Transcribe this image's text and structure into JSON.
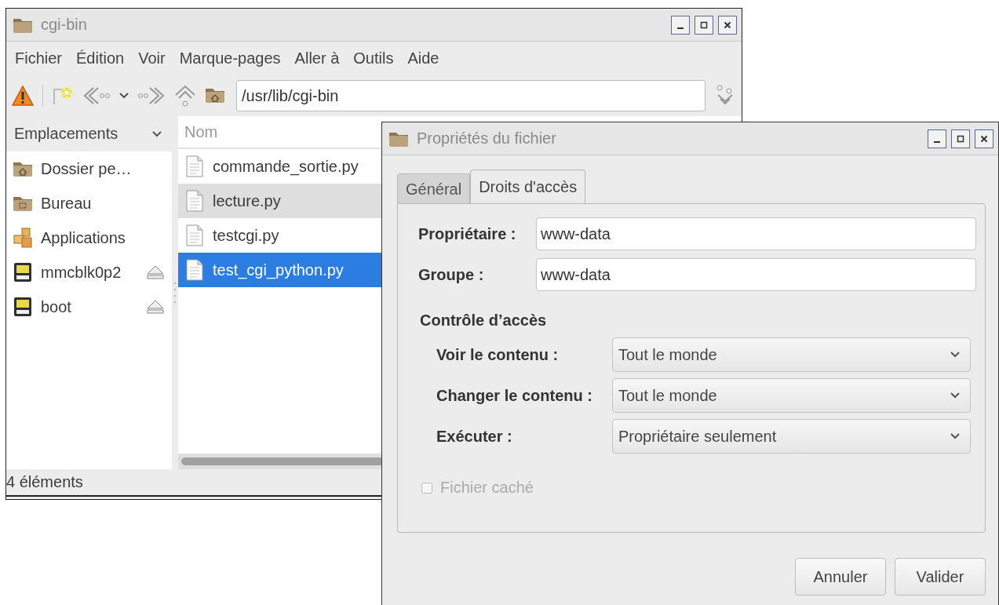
{
  "file_manager": {
    "window": {
      "title": "cgi-bin"
    },
    "menu": [
      "Fichier",
      "Édition",
      "Voir",
      "Marque-pages",
      "Aller à",
      "Outils",
      "Aide"
    ],
    "toolbar": {
      "path": "/usr/lib/cgi-bin"
    },
    "sidebar": {
      "header": "Emplacements",
      "items": [
        {
          "label": "Dossier pe…",
          "kind": "home"
        },
        {
          "label": "Bureau",
          "kind": "desktop"
        },
        {
          "label": "Applications",
          "kind": "applications"
        },
        {
          "label": "mmcblk0p2",
          "kind": "drive"
        },
        {
          "label": "boot",
          "kind": "drive"
        }
      ]
    },
    "file_list": {
      "columns": [
        "Nom"
      ],
      "rows": [
        {
          "name": "commande_sortie.py",
          "selected": false,
          "hovered": false
        },
        {
          "name": "lecture.py",
          "selected": false,
          "hovered": true
        },
        {
          "name": "testcgi.py",
          "selected": false,
          "hovered": false
        },
        {
          "name": "test_cgi_python.py",
          "selected": true,
          "hovered": false
        }
      ]
    },
    "status_bar": "4 éléments"
  },
  "dialog": {
    "window": {
      "title": "Propriétés du fichier"
    },
    "tabs": [
      {
        "label": "Général",
        "selected": false
      },
      {
        "label": "Droits d'accès",
        "selected": true
      }
    ],
    "fields": [
      {
        "label": "Propriétaire :",
        "value": "www-data"
      },
      {
        "label": "Groupe :",
        "value": "www-data"
      }
    ],
    "section": "Contrôle d’accès",
    "permissions": [
      {
        "label": "Voir le contenu :",
        "value": "Tout le monde"
      },
      {
        "label": "Changer le contenu :",
        "value": "Tout le monde"
      },
      {
        "label": "Exécuter :",
        "value": "Propriétaire seulement"
      }
    ],
    "hidden_file": {
      "label": "Fichier caché",
      "checked": false,
      "disabled": true
    },
    "buttons": [
      "Annuler",
      "Valider"
    ]
  }
}
